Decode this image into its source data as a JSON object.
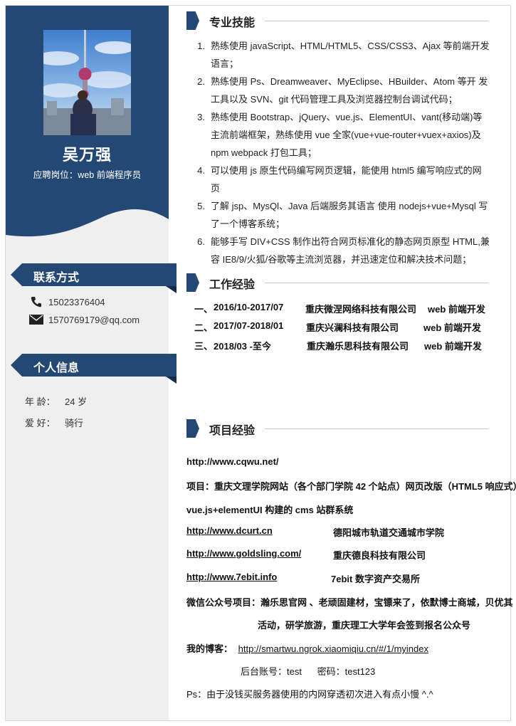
{
  "profile": {
    "name": "吴万强",
    "position": "应聘岗位：web 前端程序员"
  },
  "colors": {
    "brand": "#244874",
    "sidebar_bg": "#efefef",
    "rule": "#c9c9c9"
  },
  "contact": {
    "title": "联系方式",
    "phone": "15023376404",
    "email": "1570769179@qq.com",
    "phone_icon": "phone-icon",
    "email_icon": "envelope-icon"
  },
  "personal": {
    "title": "个人信息",
    "rows": [
      {
        "key": "年   龄：",
        "value": "24 岁"
      },
      {
        "key": "爱   好：",
        "value": "骑行"
      }
    ]
  },
  "skills": {
    "title": "专业技能",
    "items": [
      {
        "num": "1.",
        "text": "熟练使用 javaScript、HTML/HTML5、CSS/CSS3、Ajax 等前端开发语言；"
      },
      {
        "num": "2.",
        "text": "熟练使用 Ps、Dreamweaver、MyEclipse、HBuilder、Atom 等开 发工具以及 SVN、git 代码管理工具及浏览器控制台调试代码；"
      },
      {
        "num": "3.",
        "text": "熟练使用 Bootstrap、jQuery、vue.js、ElementUI、vant(移动端)等主流前端框架，熟练使用 vue 全家(vue+vue-router+vuex+axios)及 npm webpack 打包工具；"
      },
      {
        "num": "4.",
        "text": "可以使用 js 原生代码编写网页逻辑，能使用 html5 编写响应式的网页"
      },
      {
        "num": "5.",
        "text": "了解 jsp、MysQl、Java 后端服务其语言 使用 nodejs+vue+Mysql 写了一个博客系统；"
      },
      {
        "num": "6.",
        "text": "能够手写 DIV+CSS 制作出符合网页标准化的静态网页原型 HTML,兼容 IE8/9/火狐/谷歌等主流浏览器，并迅速定位和解决技术问题；"
      }
    ]
  },
  "work": {
    "title": "工作经验",
    "rows": [
      {
        "index": "一、",
        "period": "2016/10-2017/07",
        "company": "重庆微涅网络科技有限公司",
        "role": "web 前端开发"
      },
      {
        "index": "二、",
        "period": "2017/07-2018/01",
        "company": "重庆兴澜科技有限公司",
        "role": "web 前端开发"
      },
      {
        "index": "三、",
        "period": "2018/03  -至今",
        "company": "重庆瀚乐思科技有限公司",
        "role": "web 前端开发"
      }
    ]
  },
  "projects": {
    "title": "项目经验",
    "site1": "http://www.cqwu.net/",
    "project1": "项目：重庆文理学院网站（各个部门学院 42 个站点）网页改版（HTML5 响应式）",
    "project1_note": "vue.js+elementUI 构建的 cms 站群系统",
    "links": [
      {
        "url": "http://www.dcurt.cn",
        "desc": "德阳城市轨道交通城市学院"
      },
      {
        "url": "http://www.goldsling.com/",
        "desc": "重庆德良科技有限公司"
      },
      {
        "url": "http://www.7ebit.info",
        "desc": "7ebit 数字资产交易所"
      }
    ],
    "wechat_line1": "微信公众号项目：瀚乐思官网 、老顽固建材，宝镖来了，依默博士商城，贝优其",
    "wechat_line2": "活动，研学旅游，重庆理工大学年会签到报名公众号",
    "blog_label": "我的博客：",
    "blog_url": "http://smartwu.ngrok.xiaomiqiu.cn/#/1/myindex",
    "admin": "后台账号：test      密码：test123",
    "ps": "Ps：由于没钱买服务器使用的内网穿透初次进入有点小慢  ^.^"
  }
}
